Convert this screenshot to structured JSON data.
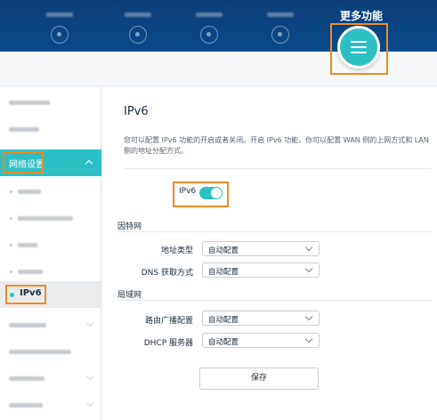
{
  "header": {
    "more_label": "更多功能",
    "menu_icon": "hamburger-menu-icon",
    "nav_icons": [
      "nav-icon",
      "nav-icon",
      "nav-icon",
      "nav-icon"
    ]
  },
  "sidebar": {
    "active_group": "网络设置",
    "selected_item": "IPv6"
  },
  "main": {
    "title": "IPv6",
    "description": "您可以配置 IPv6 功能的开启或者关闭。开启 IPv6 功能，你可以配置 WAN 侧的上网方式和 LAN 侧的地址分配方式。",
    "ipv6_toggle_label": "IPv6",
    "ipv6_enabled": true,
    "wan_section": "因特网",
    "address_type_label": "地址类型",
    "address_type_value": "自动配置",
    "dns_label": "DNS 获取方式",
    "dns_value": "自动配置",
    "lan_section": "局域网",
    "ra_label": "路由广播配置",
    "ra_value": "自动配置",
    "dhcp_label": "DHCP 服务器",
    "dhcp_value": "自动配置",
    "save_label": "保存"
  },
  "colors": {
    "header": "#0b3e78",
    "accent": "#2cc0c4",
    "highlight": "#f08a24"
  }
}
